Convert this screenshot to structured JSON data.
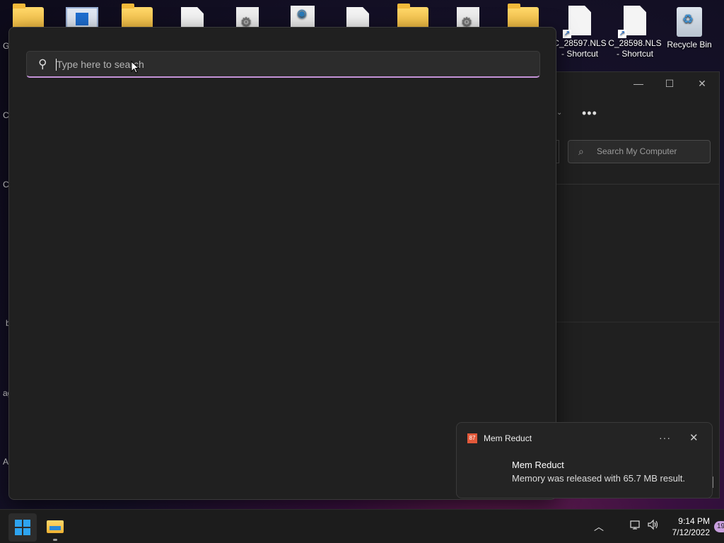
{
  "desktop": {
    "icons": [
      {
        "label": "C_28597.NLS - Shortcut"
      },
      {
        "label": "C_28598.NLS - Shortcut"
      },
      {
        "label": "Recycle Bin"
      }
    ]
  },
  "peek": [
    "G",
    "C",
    "C",
    "b",
    "ag",
    "A"
  ],
  "explorer": {
    "search_placeholder": "Search My Computer",
    "more_label": "•••",
    "minimize": "—",
    "maximize": "☐",
    "close": "✕"
  },
  "search_flyout": {
    "placeholder": "Type here to search",
    "value": ""
  },
  "toast": {
    "app_icon_text": "87",
    "app_name": "Mem Reduct",
    "more_label": "···",
    "close_label": "✕",
    "title": "Mem Reduct",
    "body": "Memory was released with 65.7 MB result."
  },
  "taskbar": {
    "tray_chevron": "︿",
    "clock_time": "9:14 PM",
    "clock_date": "7/12/2022",
    "notification_count": "19"
  }
}
